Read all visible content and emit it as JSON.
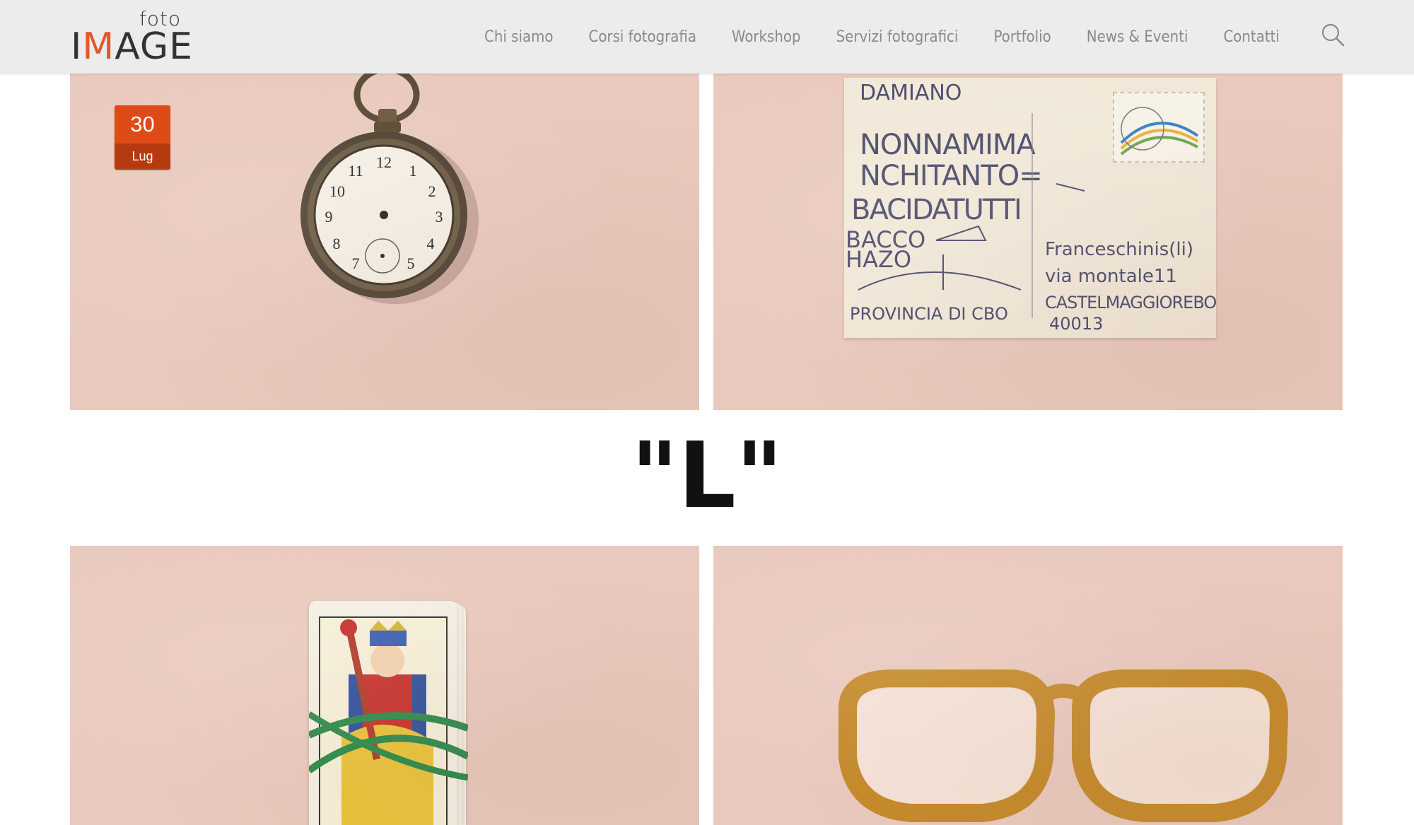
{
  "header": {
    "logo": {
      "small": "foto",
      "main_prefix": "I",
      "main_accent": "M",
      "main_suffix": "AGE"
    },
    "nav": [
      "Chi siamo",
      "Corsi fotografia",
      "Workshop",
      "Servizi fotografici",
      "Portfolio",
      "News & Eventi",
      "Contatti"
    ],
    "search_icon": "search-icon"
  },
  "post": {
    "date": {
      "day": "30",
      "month": "Lug"
    },
    "heading": "\"L\""
  },
  "postcard": {
    "top_name": "DAMIANO",
    "message_lines": [
      "NONNAMIMA",
      "NCHITANTO=",
      "BACIDATUTTI",
      "BACCO",
      "HAZO"
    ],
    "footer_left": "PROVINCIA DI CBO",
    "address_lines": [
      "Franceschinis(li)",
      "via montale11",
      "CASTELMAGGIOREBO",
      "40013"
    ]
  },
  "colors": {
    "accent": "#e2572b",
    "badge_day": "#df4b17",
    "badge_month": "#b53a10",
    "photo_bg": "#e9c9bd",
    "header_bg": "#ececec"
  }
}
